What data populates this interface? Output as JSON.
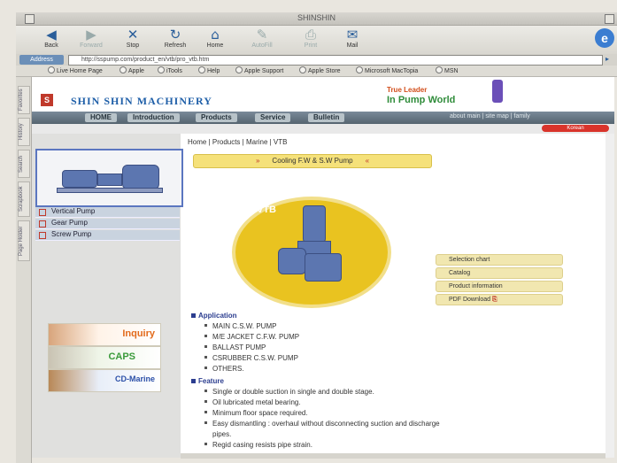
{
  "window": {
    "title": "SHINSHIN"
  },
  "toolbar": {
    "items": [
      "Back",
      "Forward",
      "Stop",
      "Refresh",
      "Home",
      "AutoFill",
      "Print",
      "Mail"
    ]
  },
  "address": {
    "label": "Address",
    "url": "http://sspump.com/product_en/vtb/pro_vtb.htm"
  },
  "favorites": [
    "Live Home Page",
    "Apple",
    "iTools",
    "Help",
    "Apple Support",
    "Apple Store",
    "Microsoft MacTopia",
    "MSN"
  ],
  "sidetabs": [
    "Favorites",
    "History",
    "Search",
    "Scrapbook",
    "Page Holder"
  ],
  "site": {
    "logo_letter": "S",
    "brand": "SHIN SHIN MACHINERY",
    "tagline_top": "True Leader",
    "tagline_main": "In Pump World"
  },
  "nav": {
    "items": [
      "HOME",
      "Introduction",
      "Products",
      "Service",
      "Bulletin"
    ],
    "right_text": "about main | site map | family",
    "enter": "Korean"
  },
  "categories": [
    "Vertical Pump",
    "Gear Pump",
    "Screw Pump"
  ],
  "promos": {
    "inquiry": "Inquiry",
    "caps": "CAPS",
    "cd": "CD-Marine"
  },
  "breadcrumb": "Home | Products | Marine | VTB",
  "heading": "Cooling F.W & S.W Pump",
  "product_code": "VTB",
  "links": [
    "Selection chart",
    "Catalog",
    "Product information",
    "PDF Download"
  ],
  "application": {
    "title": "Application",
    "items": [
      "MAIN C.S.W. PUMP",
      "M/E JACKET C.F.W. PUMP",
      "BALLAST PUMP",
      "CSRUBBER C.S.W. PUMP",
      "OTHERS."
    ]
  },
  "feature": {
    "title": "Feature",
    "items": [
      "Single or double suction in single and double stage.",
      "Oil lubricated metal bearing.",
      "Minimum floor space required.",
      "Easy dismantling : overhaul without disconnecting suction and discharge",
      "pipes.",
      "Regid casing resists pipe strain."
    ]
  },
  "colors": {
    "brand_blue": "#1f5fa8",
    "accent_yellow": "#e9c320",
    "accent_red": "#d9342b"
  }
}
